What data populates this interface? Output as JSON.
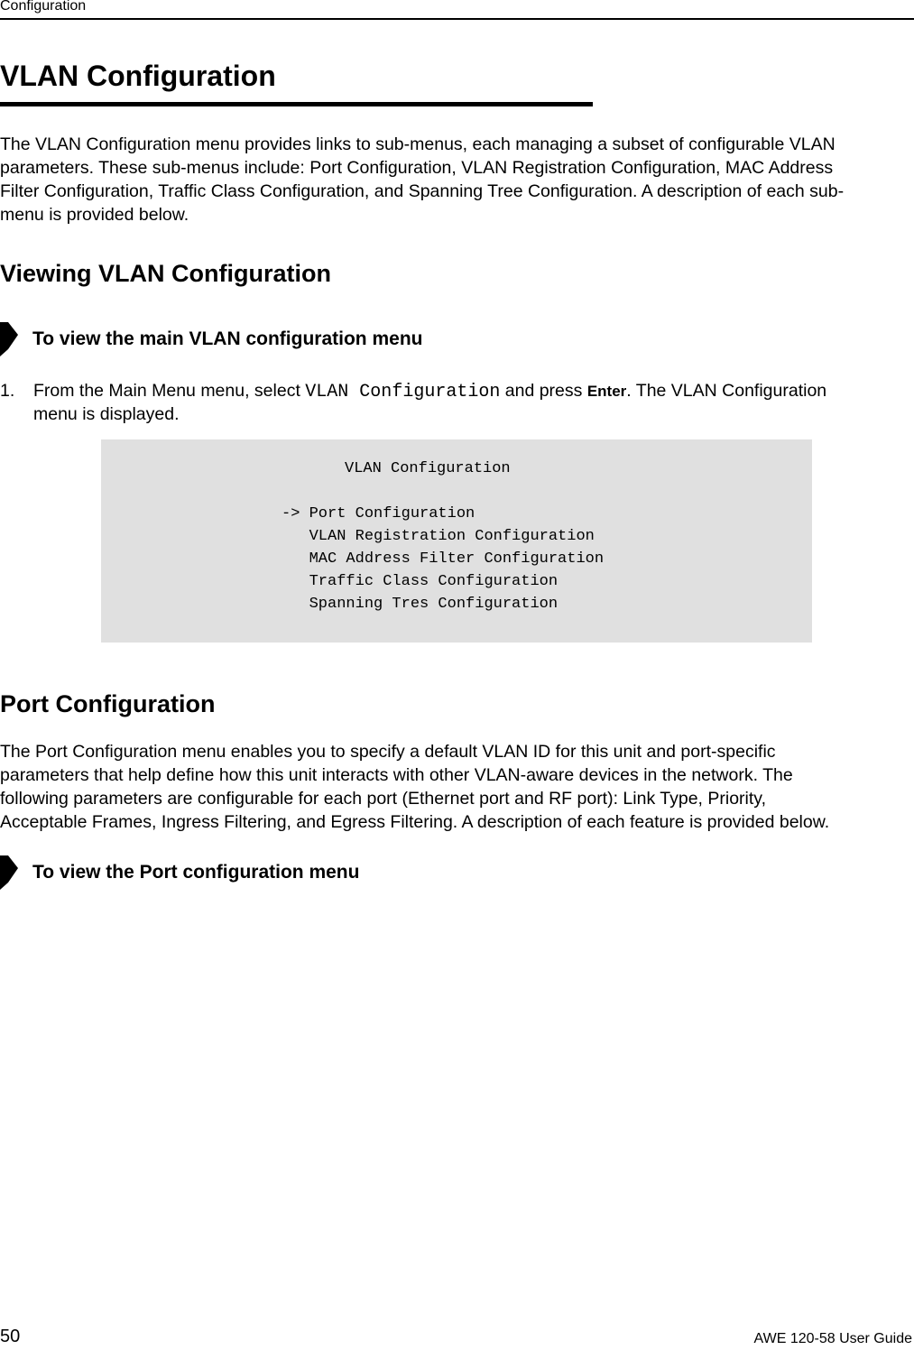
{
  "header": {
    "section": "Configuration"
  },
  "title": "VLAN Configuration",
  "intro_lines": [
    "The VLAN Configuration menu provides links to sub-menus, each managing a subset of configurable VLAN",
    "parameters. These sub-menus include: Port Configuration, VLAN Registration Configuration, MAC Address",
    "Filter Configuration, Traffic Class Configuration, and Spanning Tree Configuration. A description of each sub-",
    "menu is provided below."
  ],
  "viewing": {
    "heading": "Viewing VLAN Configuration",
    "procedure": "To view the main VLAN configuration menu",
    "step": {
      "number": "1.",
      "pre": "From the Main Menu menu, select ",
      "code": "VLAN Configuration",
      "mid": " and press ",
      "key": "Enter",
      "post": ".   The VLAN Configuration",
      "line2": "menu is displayed."
    },
    "screen": {
      "title": "VLAN Configuration",
      "selector": "->",
      "items": [
        "Port Configuration",
        "VLAN Registration Configuration",
        "MAC Address Filter Configuration",
        "Traffic Class Configuration",
        "Spanning Tres Configuration"
      ]
    }
  },
  "port": {
    "heading": "Port Configuration",
    "lines": [
      "The Port Configuration menu enables you to specify a default VLAN ID for this unit and port-specific",
      "parameters that help define how this unit interacts with other VLAN-aware devices in the network. The",
      "following parameters are configurable for each port (Ethernet port and RF port): Link Type, Priority,",
      "Acceptable Frames, Ingress Filtering, and Egress Filtering. A description of each feature is provided below."
    ],
    "procedure": "To view the Port configuration menu"
  },
  "footer": {
    "page_number": "50",
    "guide": "AWE 120-58 User Guide"
  }
}
